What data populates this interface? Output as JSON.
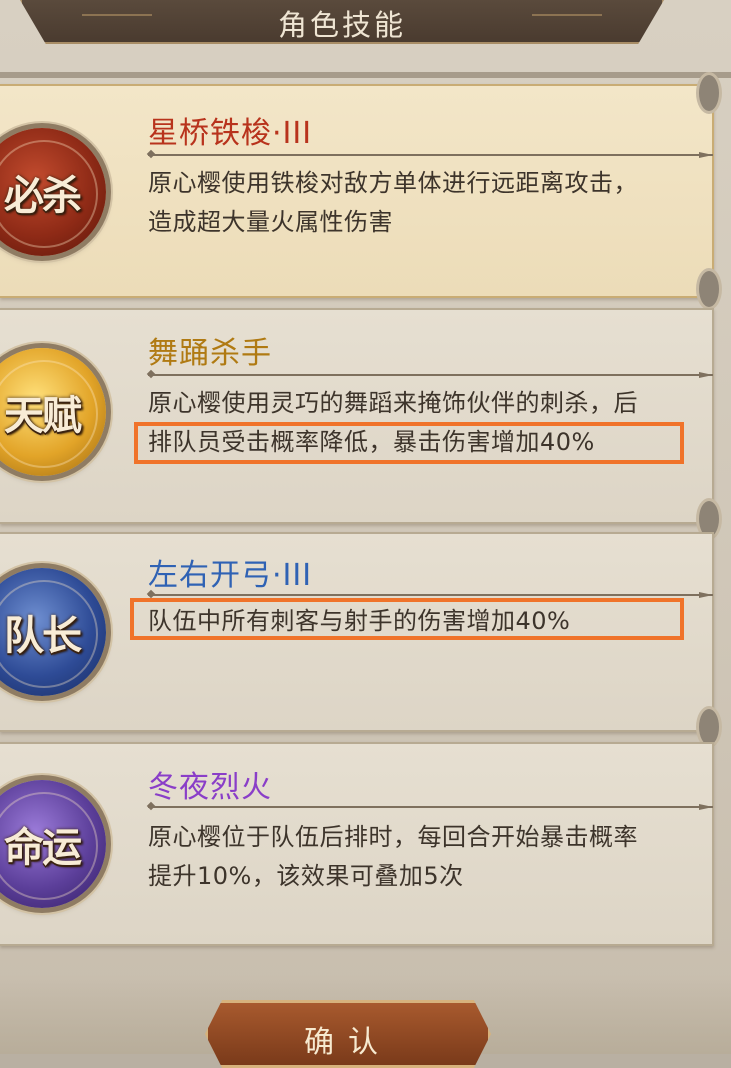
{
  "header": {
    "title": "角色技能"
  },
  "skills": [
    {
      "badge": "必杀",
      "title": "星桥铁梭·III",
      "title_color": "#b8331c",
      "desc_line1": "原心樱使用铁梭对敌方单体进行远距离攻击，",
      "desc_line2": "造成超大量火属性伤害"
    },
    {
      "badge": "天赋",
      "title": "舞踊杀手",
      "title_color": "#b07a12",
      "desc_line1": "原心樱使用灵巧的舞蹈来掩饰伙伴的刺杀，后",
      "desc_line2": "排队员受击概率降低，暴击伤害增加40%"
    },
    {
      "badge": "队长",
      "title": "左右开弓·III",
      "title_color": "#2f62b4",
      "desc_line1": "队伍中所有刺客与射手的伤害增加40%",
      "desc_line2": ""
    },
    {
      "badge": "命运",
      "title": "冬夜烈火",
      "title_color": "#8a3ec8",
      "desc_line1": "原心樱位于队伍后排时，每回合开始暴击概率",
      "desc_line2": "提升10%，该效果可叠加5次"
    }
  ],
  "confirm": {
    "label": "确认"
  },
  "colors": {
    "annotation_box": "#f0732a"
  }
}
